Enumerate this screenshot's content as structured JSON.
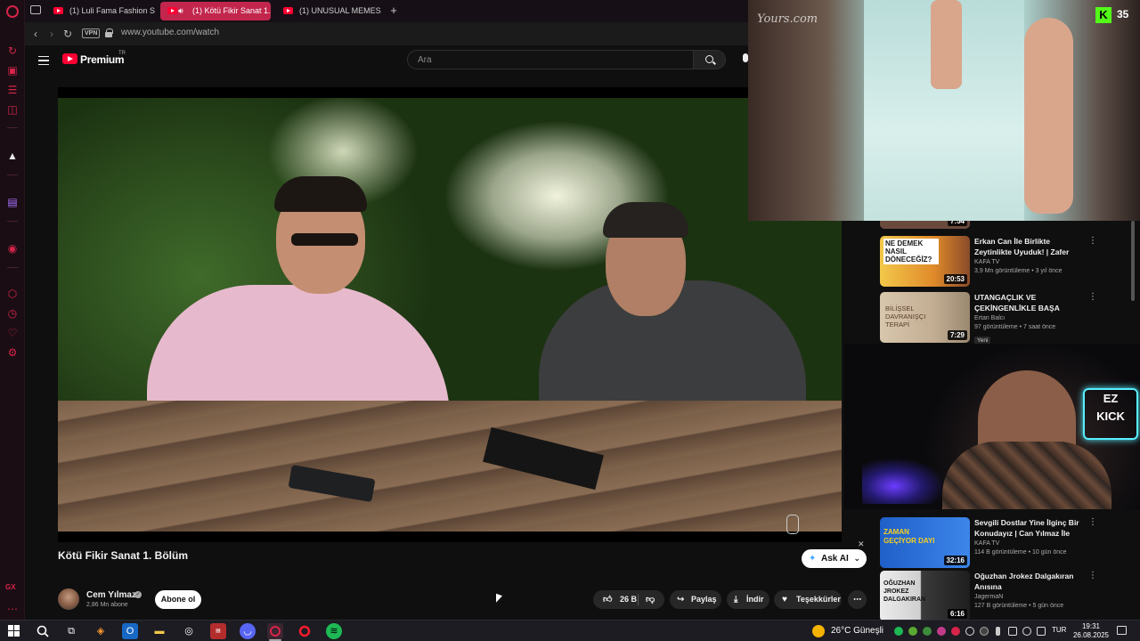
{
  "browser": {
    "tabs": [
      {
        "label": "(1) Luli Fama Fashion Sho"
      },
      {
        "label": "(1) Kötü Fikir Sanat 1."
      },
      {
        "label": "(1) UNUSUAL MEMES CO"
      }
    ],
    "vpn_badge": "VPN",
    "url": "www.youtube.com/watch",
    "sidebar_label": "GX"
  },
  "youtube": {
    "logo_text": "Premium",
    "logo_country": "TR",
    "search_placeholder": "Ara"
  },
  "video": {
    "title": "Kötü Fikir Sanat 1. Bölüm",
    "ask_ai_label": "Ask AI",
    "channel_name": "Cem Yılmaz",
    "subscribers": "2,86 Mn abone",
    "subscribe_label": "Abone ol",
    "like_count": "26 B",
    "share_label": "Paylaş",
    "download_label": "İndir",
    "thanks_label": "Teşekkürler"
  },
  "overlay": {
    "watermark": "Yours.com",
    "kick_count": "35",
    "ez_text": "EZ",
    "kick_text": "KICK"
  },
  "recommendations": [
    {
      "title": "",
      "channel": "",
      "meta": "",
      "duration": "7:54",
      "thumb_color": "#6b4a3e"
    },
    {
      "title": "Erkan Can İle Birlikte Zeytinlikte Uyuduk! | Zafer Algöz Anlatıyor",
      "channel": "KAFA TV",
      "meta": "3,9 Mn görüntüleme • 3 yıl önce",
      "duration": "20:53",
      "thumb_color": "#d98a2b",
      "thumb_text": "NE DEMEK NASIL DÖNECEĞİZ?"
    },
    {
      "title": "UTANGAÇLIK VE ÇEKİNGENLİKLE BAŞA ÇIKMA...",
      "channel": "Ertan Balcı",
      "meta": "97 görüntüleme • 7 saat önce",
      "duration": "7:29",
      "thumb_color": "#c8b49a",
      "thumb_text": "BİLİŞSEL DAVRANIŞÇI TERAPİ",
      "badge": "Yeni"
    },
    {
      "title": "Sevgili Dostlar Yine İlginç Bir Konudayız | Can Yılmaz İle Ger...",
      "channel": "KAFA TV",
      "meta": "114 B görüntüleme • 10 gün önce",
      "duration": "32:16",
      "thumb_color": "#2a6fd6",
      "thumb_text": "ZAMAN GEÇİYOR DAYI"
    },
    {
      "title": "Oğuzhan Jrokez Dalgakıran Anısına",
      "channel": "JagermaN",
      "meta": "127 B görüntüleme • 5 gün önce",
      "duration": "6:16",
      "thumb_color": "#2a2a2a",
      "thumb_text": "OĞUZHAN JROKEZ DALGAKIRAN"
    }
  ],
  "taskbar": {
    "weather": "26°C  Güneşli",
    "language": "TUR",
    "time": "19:31",
    "date": "26.08.2025"
  }
}
